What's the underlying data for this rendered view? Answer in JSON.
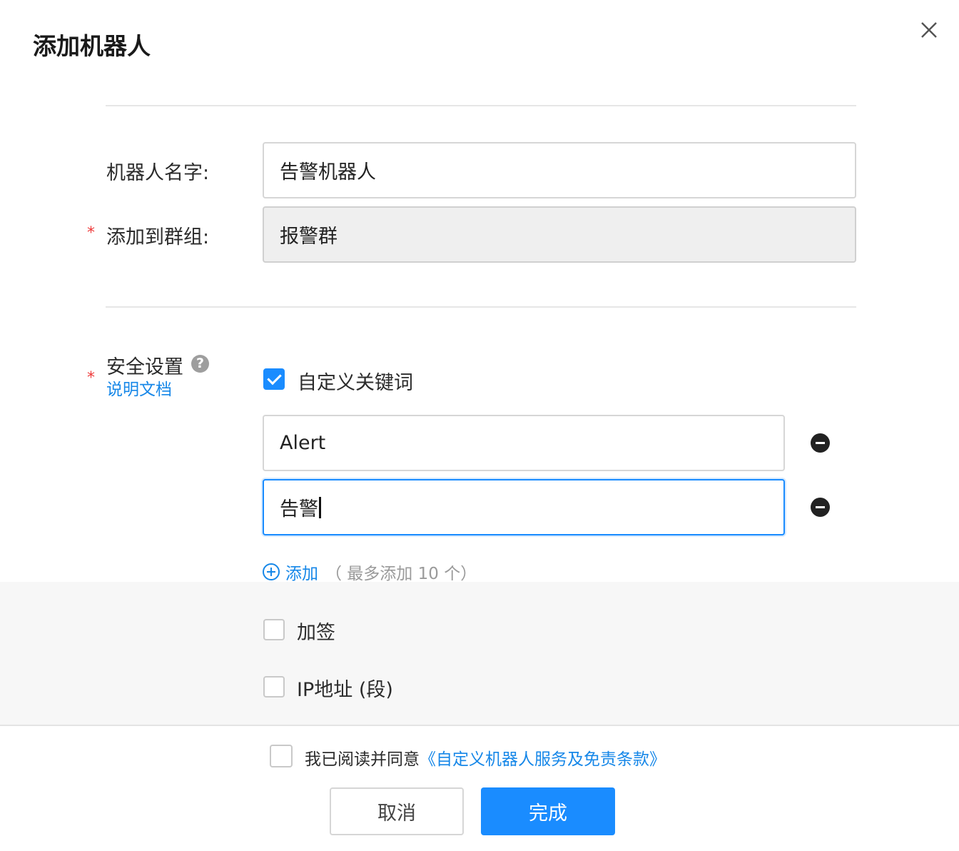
{
  "dialog": {
    "title": "添加机器人",
    "close_icon": "close-icon"
  },
  "form": {
    "name_label": "机器人名字:",
    "name_value": "告警机器人",
    "group_label": "添加到群组:",
    "group_required": "*",
    "group_value": "报警群"
  },
  "security": {
    "label": "安全设置",
    "required": "*",
    "help_icon": "?",
    "doc_link": "说明文档",
    "keyword_option": {
      "label": "自定义关键词",
      "checked": true
    },
    "keywords": [
      "Alert",
      "告警"
    ],
    "add_label": "添加",
    "add_hint": "（ 最多添加 10 个）",
    "sign_option": {
      "label": "加签",
      "checked": false
    },
    "ip_option": {
      "label": "IP地址 (段)",
      "checked": false
    }
  },
  "footer": {
    "agree_text": "我已阅读并同意",
    "agree_link": "《自定义机器人服务及免责条款》",
    "agree_checked": false,
    "cancel_label": "取消",
    "ok_label": "完成"
  },
  "colors": {
    "accent": "#1a8cff",
    "link": "#1687e8",
    "required": "#ee3b3b"
  }
}
